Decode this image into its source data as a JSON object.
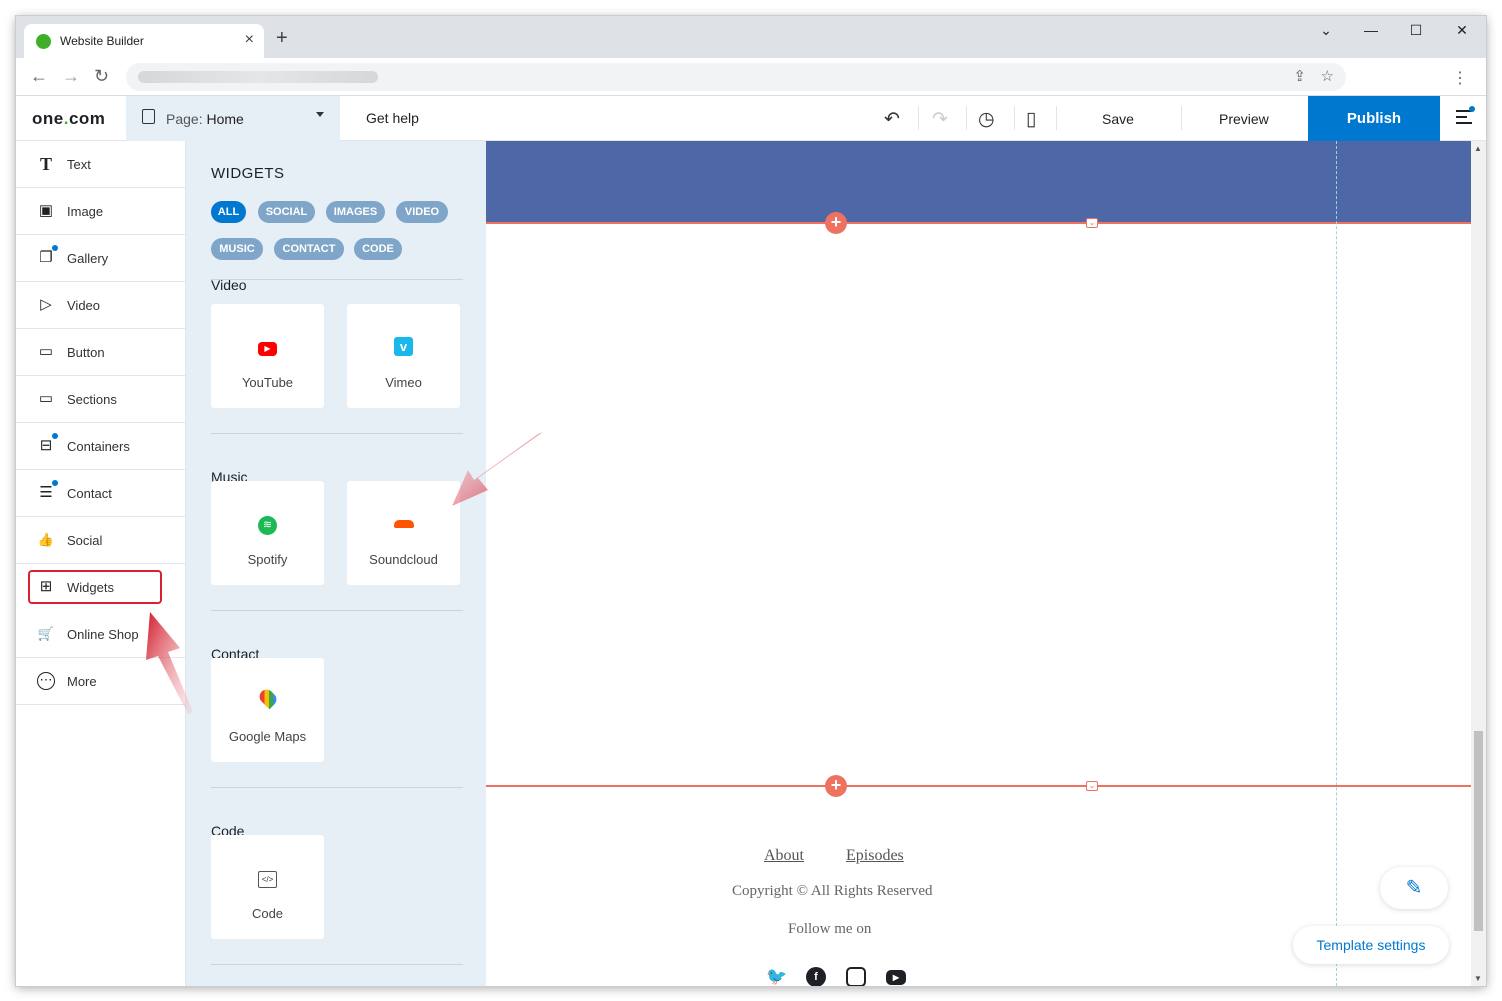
{
  "browser": {
    "tab_title": "Website Builder",
    "tab_close": "×",
    "new_tab": "+",
    "controls": {
      "minimize": "—",
      "maximize": "☐",
      "close": "✕",
      "tab_list": "⌄"
    }
  },
  "app": {
    "logo_main": "one",
    "logo_dot": ".",
    "logo_end": "com",
    "page_prefix": "Page:",
    "page_name": "Home",
    "get_help": "Get help",
    "save": "Save",
    "preview": "Preview",
    "publish": "Publish"
  },
  "sidebar": {
    "items": [
      {
        "label": "Text",
        "icon": "T"
      },
      {
        "label": "Image",
        "icon": "▣"
      },
      {
        "label": "Gallery",
        "icon": "❐"
      },
      {
        "label": "Video",
        "icon": "▷"
      },
      {
        "label": "Button",
        "icon": "▭"
      },
      {
        "label": "Sections",
        "icon": "▭"
      },
      {
        "label": "Containers",
        "icon": "⊟"
      },
      {
        "label": "Contact",
        "icon": "☰"
      },
      {
        "label": "Social",
        "icon": "👍"
      },
      {
        "label": "Widgets",
        "icon": "⊞"
      },
      {
        "label": "Online Shop",
        "icon": "🛒"
      },
      {
        "label": "More",
        "icon": "⋯"
      }
    ]
  },
  "widgets_panel": {
    "title": "WIDGETS",
    "filters": [
      "ALL",
      "SOCIAL",
      "IMAGES",
      "VIDEO",
      "MUSIC",
      "CONTACT",
      "CODE"
    ],
    "active_filter": "ALL",
    "sections": {
      "video": {
        "title": "Video",
        "items": [
          "YouTube",
          "Vimeo"
        ]
      },
      "music": {
        "title": "Music",
        "items": [
          "Spotify",
          "Soundcloud"
        ]
      },
      "contact": {
        "title": "Contact",
        "items": [
          "Google Maps"
        ]
      },
      "code": {
        "title": "Code",
        "items": [
          "Code"
        ]
      }
    }
  },
  "canvas": {
    "footer_links": [
      "About",
      "Episodes"
    ],
    "copyright": "Copyright © All Rights Reserved",
    "follow": "Follow me on",
    "template_settings": "Template settings"
  },
  "colors": {
    "accent": "#0078d0",
    "header_band": "#4e67a6",
    "section_line": "#ef7260",
    "annotation": "#d92231"
  }
}
